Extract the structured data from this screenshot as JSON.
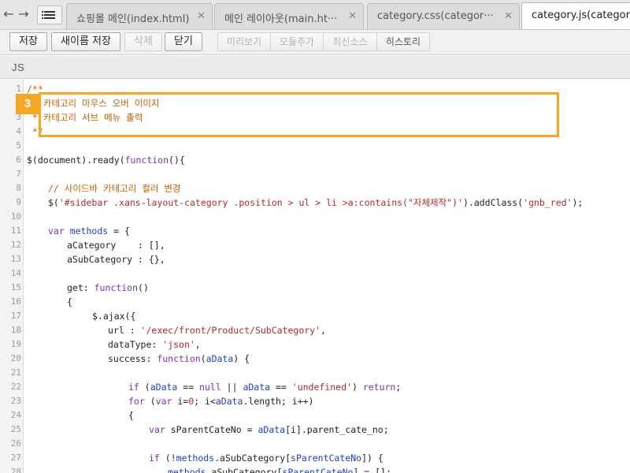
{
  "tabs": [
    {
      "label": "쇼핑몰 메인(index.html)",
      "close": "✕"
    },
    {
      "label": "메인 레이아웃(main.ht···",
      "close": "✕"
    },
    {
      "label": "category.css(categor···",
      "close": "✕"
    },
    {
      "label": "category.js(category.js",
      "close": ""
    }
  ],
  "nav": {
    "back": "←",
    "forward": "→"
  },
  "toolbar": {
    "save": "저장",
    "save_as": "새이름 저장",
    "delete": "삭제",
    "close": "닫기",
    "group": [
      "미리보기",
      "모듈추가",
      "최신소스",
      "히스토리"
    ]
  },
  "section": {
    "label": "JS"
  },
  "annotation": {
    "badge": "3",
    "color": "#f5a623"
  },
  "colors": {
    "comment": "#c06000",
    "keyword": "#7b2fb0",
    "string": "#b02a2a",
    "identifier": "#1f3fbf"
  },
  "code_lines": [
    {
      "n": "1",
      "indent": 0,
      "tokens": [
        {
          "t": "/**",
          "c": "comment"
        }
      ]
    },
    {
      "n": "2",
      "indent": 0,
      "tokens": [
        {
          "t": " * 카테고리 마우스 오버 이미지",
          "c": "comment"
        }
      ]
    },
    {
      "n": "3",
      "indent": 0,
      "tokens": [
        {
          "t": " * 카테고리 서브 메뉴 출력",
          "c": "comment"
        }
      ]
    },
    {
      "n": "4",
      "indent": 0,
      "tokens": [
        {
          "t": " */",
          "c": "comment"
        }
      ]
    },
    {
      "n": "5",
      "indent": 0,
      "tokens": []
    },
    {
      "n": "6",
      "indent": 0,
      "tokens": [
        {
          "t": "$(document).ready(",
          "c": "plain"
        },
        {
          "t": "function",
          "c": "kw"
        },
        {
          "t": "(){",
          "c": "plain"
        }
      ]
    },
    {
      "n": "7",
      "indent": 0,
      "tokens": []
    },
    {
      "n": "8",
      "indent": 1,
      "tokens": [
        {
          "t": "// 사이드바 카테고리 컬러 변경",
          "c": "comment"
        }
      ]
    },
    {
      "n": "9",
      "indent": 1,
      "tokens": [
        {
          "t": "$(",
          "c": "plain"
        },
        {
          "t": "'#sidebar .xans-layout-category .position > ul > li >a:contains(\"자체제작\")'",
          "c": "str"
        },
        {
          "t": ").addClass(",
          "c": "plain"
        },
        {
          "t": "'gnb_red'",
          "c": "str"
        },
        {
          "t": ");",
          "c": "plain"
        }
      ]
    },
    {
      "n": "10",
      "indent": 0,
      "tokens": []
    },
    {
      "n": "11",
      "indent": 1,
      "tokens": [
        {
          "t": "var",
          "c": "kw"
        },
        {
          "t": " methods",
          "c": "ident"
        },
        {
          "t": " = {",
          "c": "plain"
        }
      ]
    },
    {
      "n": "12",
      "indent": 2,
      "tokens": [
        {
          "t": "aCategory    : [],",
          "c": "plain"
        }
      ]
    },
    {
      "n": "13",
      "indent": 2,
      "tokens": [
        {
          "t": "aSubCategory : {},",
          "c": "plain"
        }
      ]
    },
    {
      "n": "14",
      "indent": 0,
      "tokens": []
    },
    {
      "n": "15",
      "indent": 2,
      "tokens": [
        {
          "t": "get: ",
          "c": "plain"
        },
        {
          "t": "function",
          "c": "kw"
        },
        {
          "t": "()",
          "c": "plain"
        }
      ]
    },
    {
      "n": "16",
      "indent": 2,
      "tokens": [
        {
          "t": "{",
          "c": "plain"
        }
      ]
    },
    {
      "n": "17",
      "indent": 3,
      "tokens": [
        {
          "t": "$.ajax({",
          "c": "plain"
        }
      ]
    },
    {
      "n": "18",
      "indent": 4,
      "tokens": [
        {
          "t": "url : ",
          "c": "plain"
        },
        {
          "t": "'/exec/front/Product/SubCategory'",
          "c": "str"
        },
        {
          "t": ",",
          "c": "plain"
        }
      ]
    },
    {
      "n": "19",
      "indent": 4,
      "tokens": [
        {
          "t": "dataType: ",
          "c": "plain"
        },
        {
          "t": "'json'",
          "c": "str"
        },
        {
          "t": ",",
          "c": "plain"
        }
      ]
    },
    {
      "n": "20",
      "indent": 4,
      "tokens": [
        {
          "t": "success: ",
          "c": "plain"
        },
        {
          "t": "function",
          "c": "kw"
        },
        {
          "t": "(",
          "c": "plain"
        },
        {
          "t": "aData",
          "c": "ident"
        },
        {
          "t": ") {",
          "c": "plain"
        }
      ]
    },
    {
      "n": "21",
      "indent": 0,
      "tokens": []
    },
    {
      "n": "22",
      "indent": 5,
      "tokens": [
        {
          "t": "if",
          "c": "kw"
        },
        {
          "t": " (",
          "c": "plain"
        },
        {
          "t": "aData",
          "c": "ident"
        },
        {
          "t": " == ",
          "c": "plain"
        },
        {
          "t": "null",
          "c": "kw"
        },
        {
          "t": " || ",
          "c": "plain"
        },
        {
          "t": "aData",
          "c": "ident"
        },
        {
          "t": " == ",
          "c": "plain"
        },
        {
          "t": "'undefined'",
          "c": "str"
        },
        {
          "t": ") ",
          "c": "plain"
        },
        {
          "t": "return",
          "c": "kw"
        },
        {
          "t": ";",
          "c": "plain"
        }
      ]
    },
    {
      "n": "23",
      "indent": 5,
      "tokens": [
        {
          "t": "for",
          "c": "kw"
        },
        {
          "t": " (",
          "c": "plain"
        },
        {
          "t": "var",
          "c": "kw"
        },
        {
          "t": " i=",
          "c": "plain"
        },
        {
          "t": "0",
          "c": "str"
        },
        {
          "t": "; i<",
          "c": "plain"
        },
        {
          "t": "aData",
          "c": "ident"
        },
        {
          "t": ".length; i++)",
          "c": "plain"
        }
      ]
    },
    {
      "n": "24",
      "indent": 5,
      "tokens": [
        {
          "t": "{",
          "c": "plain"
        }
      ]
    },
    {
      "n": "25",
      "indent": 6,
      "tokens": [
        {
          "t": "var",
          "c": "kw"
        },
        {
          "t": " sParentCateNo = ",
          "c": "plain"
        },
        {
          "t": "aData",
          "c": "ident"
        },
        {
          "t": "[i].parent_cate_no;",
          "c": "plain"
        }
      ]
    },
    {
      "n": "26",
      "indent": 0,
      "tokens": []
    },
    {
      "n": "27",
      "indent": 6,
      "tokens": [
        {
          "t": "if",
          "c": "kw"
        },
        {
          "t": " (!",
          "c": "plain"
        },
        {
          "t": "methods",
          "c": "ident"
        },
        {
          "t": ".aSubCategory[",
          "c": "plain"
        },
        {
          "t": "sParentCateNo",
          "c": "ident"
        },
        {
          "t": "]) {",
          "c": "plain"
        }
      ]
    },
    {
      "n": "28",
      "indent": 7,
      "tokens": [
        {
          "t": "methods",
          "c": "ident"
        },
        {
          "t": ".aSubCategory[",
          "c": "plain"
        },
        {
          "t": "sParentCateNo",
          "c": "ident"
        },
        {
          "t": "] = [];",
          "c": "plain"
        }
      ]
    }
  ]
}
